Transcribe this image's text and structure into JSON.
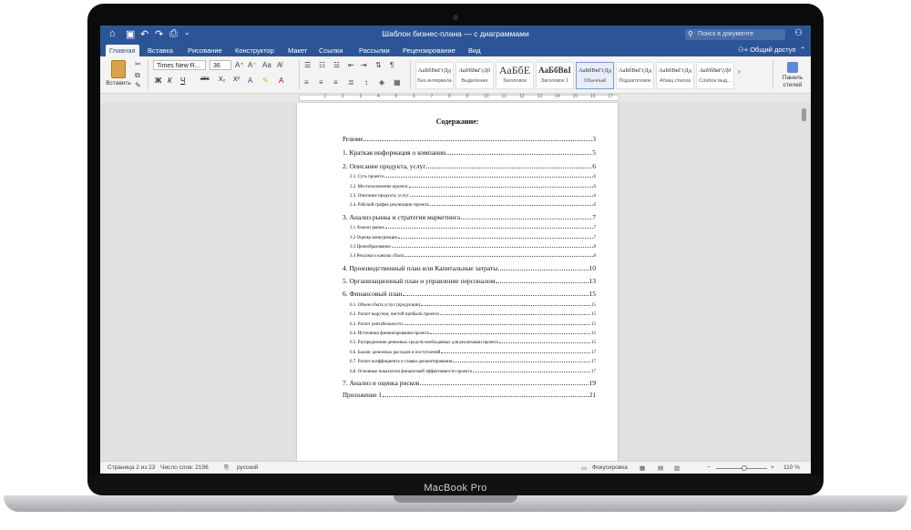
{
  "window": {
    "title": "Шаблон бизнес-плана — с диаграммами"
  },
  "search": {
    "placeholder": "Поиск в документе"
  },
  "share": {
    "label": "Общий доступ"
  },
  "tabs": [
    "Главная",
    "Вставка",
    "Рисование",
    "Конструктор",
    "Макет",
    "Ссылки",
    "Рассылки",
    "Рецензирование",
    "Вид"
  ],
  "ribbon": {
    "paste_label": "Вставить",
    "font": "Times New R...",
    "size": "36",
    "styles": [
      {
        "sample": "АаБбВвГгДд",
        "name": "Без интервала"
      },
      {
        "sample": "АаБбВвГгДд",
        "name": "Выделение"
      },
      {
        "sample": "АаБбЕ",
        "name": "Заголовок"
      },
      {
        "sample": "АаБбВвI",
        "name": "Заголовок 1"
      },
      {
        "sample": "АаБбВвГгДд",
        "name": "Обычный"
      },
      {
        "sample": "АаБбВвГгДд",
        "name": "Подзаголовок"
      },
      {
        "sample": "АаБбВвГгДд",
        "name": "Абзац списка"
      },
      {
        "sample": "АаБбВвГгДд",
        "name": "Слабое выд..."
      }
    ],
    "panel_label": "Панель стилей"
  },
  "document": {
    "toc_title": "Содержание:",
    "toc": [
      {
        "text": "Резюме",
        "page": "3",
        "level": 0
      },
      {
        "text": "1. Краткая информация о компании",
        "page": "5",
        "level": 1
      },
      {
        "text": "2. Описание продукта, услуг",
        "page": "6",
        "level": 1
      },
      {
        "text": "2.1. Суть проекта",
        "page": "6",
        "level": 2
      },
      {
        "text": "2.2. Местоположение проекта",
        "page": "6",
        "level": 2
      },
      {
        "text": "2.3. Описание продукта, услуг",
        "page": "6",
        "level": 2
      },
      {
        "text": "2.4. Рабочий график реализации проекта",
        "page": "6",
        "level": 2
      },
      {
        "text": "3. Анализ рынка и стратегия маркетинга",
        "page": "7",
        "level": 1
      },
      {
        "text": "3.1 Анализ рынка",
        "page": "7",
        "level": 2
      },
      {
        "text": "3.2 Оценка конкуренции",
        "page": "7",
        "level": 2
      },
      {
        "text": "3.3 Ценообразование",
        "page": "8",
        "level": 2
      },
      {
        "text": "3.4 Реклама и каналы сбыта",
        "page": "8",
        "level": 2
      },
      {
        "text": "4. Производственный план или Капитальные затраты",
        "page": "10",
        "level": 1
      },
      {
        "text": "5. Организационный план и управление персоналом",
        "page": "13",
        "level": 1
      },
      {
        "text": "6. Финансовый план",
        "page": "15",
        "level": 1
      },
      {
        "text": "6.1. Объем сбыта услуг (продукции)",
        "page": "15",
        "level": 2
      },
      {
        "text": "6.2. Расчет выручки, чистой прибыли проекта",
        "page": "15",
        "level": 2
      },
      {
        "text": "6.3. Расчет рентабельности",
        "page": "15",
        "level": 2
      },
      {
        "text": "6.4. Источники финансирования проекта",
        "page": "15",
        "level": 2
      },
      {
        "text": "6.5. Распределение денежных средств необходимых для реализации проекта",
        "page": "15",
        "level": 2
      },
      {
        "text": "6.6. Баланс денежных расходов и поступлений",
        "page": "17",
        "level": 2
      },
      {
        "text": "6.7. Расчет коэффициента и ставки дисконтирования",
        "page": "17",
        "level": 2
      },
      {
        "text": "6.8. Основные показатели финансовой эффективности проекта",
        "page": "17",
        "level": 2
      },
      {
        "text": "7. Анализ и оценка рисков",
        "page": "19",
        "level": 1
      },
      {
        "text": "Приложение 1",
        "page": "21",
        "level": 0
      }
    ]
  },
  "status": {
    "page": "Страница 2 из 23",
    "words": "Число слов: 2196",
    "lang": "русский",
    "focus": "Фокусировка",
    "zoom": "110 %",
    "zoom_level": 0.55
  },
  "device": {
    "brand": "MacBook Pro"
  }
}
